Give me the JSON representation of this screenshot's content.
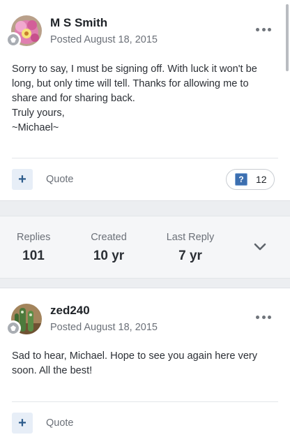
{
  "posts": [
    {
      "author": "M S Smith",
      "date": "Posted August 18, 2015",
      "body": [
        "Sorry to say, I must be signing off. With luck it won't be long, but only time will tell. Thanks for allowing me to share and for sharing back.",
        "Truly yours,",
        "~Michael~"
      ],
      "quote_label": "Quote",
      "reaction": {
        "icon": "question-reaction-icon",
        "glyph": "?",
        "count": "12"
      }
    },
    {
      "author": "zed240",
      "date": "Posted August 18, 2015",
      "body": [
        "Sad to hear, Michael. Hope to see you again here very soon. All the best!"
      ],
      "quote_label": "Quote"
    }
  ],
  "stats": {
    "replies_label": "Replies",
    "replies_value": "101",
    "created_label": "Created",
    "created_value": "10 yr",
    "last_reply_label": "Last Reply",
    "last_reply_value": "7 yr"
  },
  "colors": {
    "accent": "#2d5c8c",
    "reaction": "#3c6fb0"
  }
}
